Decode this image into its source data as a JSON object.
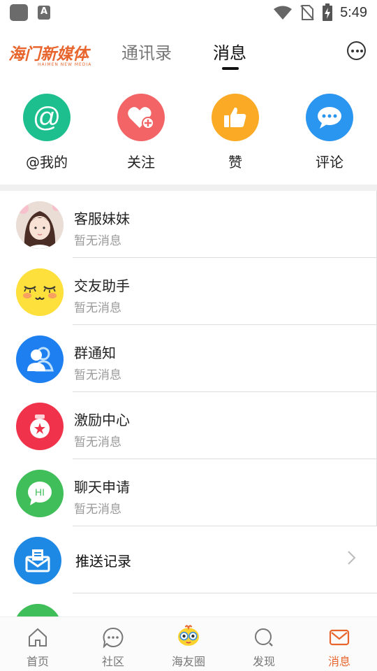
{
  "status_bar": {
    "time": "5:49",
    "notification_badge": "A",
    "icons": [
      "app-icon",
      "wifi-icon",
      "no-sim-icon",
      "battery-charging-icon"
    ]
  },
  "header": {
    "logo_text": "海门新媒体",
    "logo_subtitle": "HAIMEN NEW MEDIA",
    "tabs": [
      {
        "label": "通讯录",
        "active": false
      },
      {
        "label": "消息",
        "active": true
      }
    ],
    "more_icon": "more-icon"
  },
  "quick_actions": [
    {
      "label": "@我的",
      "icon": "at-icon",
      "color": "#1dbf8e"
    },
    {
      "label": "关注",
      "icon": "heart-plus-icon",
      "color": "#f26465"
    },
    {
      "label": "赞",
      "icon": "thumbs-up-icon",
      "color": "#fbaa25"
    },
    {
      "label": "评论",
      "icon": "comment-icon",
      "color": "#2b96ef"
    }
  ],
  "conversations": [
    {
      "title": "客服妹妹",
      "subtitle": "暂无消息",
      "avatar": "girl-photo-avatar"
    },
    {
      "title": "交友助手",
      "subtitle": "暂无消息",
      "avatar": "smiley-face-avatar"
    },
    {
      "title": "群通知",
      "subtitle": "暂无消息",
      "avatar": "group-icon",
      "color": "#1e7ff0"
    },
    {
      "title": "激励中心",
      "subtitle": "暂无消息",
      "avatar": "medal-icon",
      "color": "#f0334a"
    },
    {
      "title": "聊天申请",
      "subtitle": "暂无消息",
      "avatar": "chat-hi-icon",
      "color": "#3fbe5a"
    }
  ],
  "push_record": {
    "title": "推送记录",
    "icon": "mail-icon",
    "color": "#1e88e5"
  },
  "bottom_nav": [
    {
      "label": "首页",
      "icon": "home-icon",
      "active": false
    },
    {
      "label": "社区",
      "icon": "chat-dots-icon",
      "active": false
    },
    {
      "label": "海友圈",
      "icon": "mascot-icon",
      "active": false
    },
    {
      "label": "发现",
      "icon": "discover-icon",
      "active": false
    },
    {
      "label": "消息",
      "icon": "envelope-icon",
      "active": true
    }
  ],
  "colors": {
    "accent": "#e8662e",
    "divider": "#f0f0f0",
    "muted": "#9a9a9a"
  }
}
